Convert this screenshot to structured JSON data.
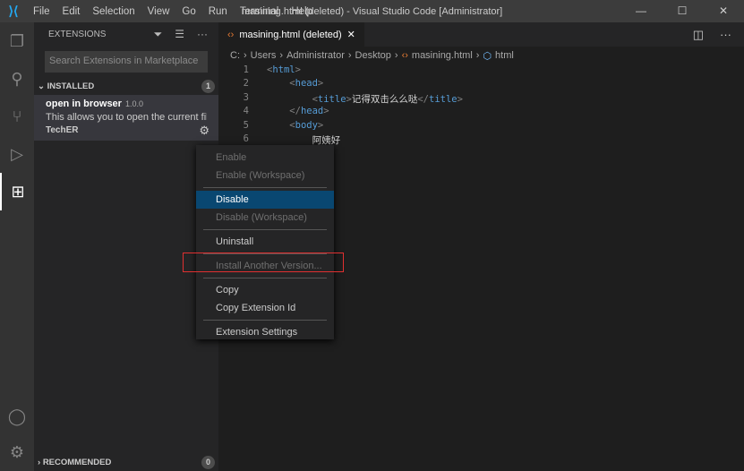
{
  "menu": [
    "File",
    "Edit",
    "Selection",
    "View",
    "Go",
    "Run",
    "Terminal",
    "Help"
  ],
  "window_title": "masining.html (deleted) - Visual Studio Code [Administrator]",
  "sidebar": {
    "title": "EXTENSIONS",
    "search_placeholder": "Search Extensions in Marketplace",
    "installed": {
      "label": "INSTALLED",
      "count": "1"
    },
    "extension": {
      "name": "open in browser",
      "version": "1.0.0",
      "description": "This allows you to open the current fil...",
      "author": "TechER"
    },
    "recommended": {
      "label": "RECOMMENDED",
      "count": "0"
    }
  },
  "editor": {
    "tab": "masining.html (deleted)",
    "breadcrumb": [
      "C:",
      "Users",
      "Administrator",
      "Desktop",
      "masining.html",
      "html"
    ],
    "lines": [
      {
        "n": "1",
        "indent": "",
        "open": "<",
        "tag": "html",
        "close": ">",
        "text": ""
      },
      {
        "n": "2",
        "indent": "    ",
        "open": "<",
        "tag": "head",
        "close": ">",
        "text": ""
      },
      {
        "n": "3",
        "indent": "        ",
        "open": "<",
        "tag": "title",
        "close": ">",
        "text": "记得双击么么哒",
        "end": "title"
      },
      {
        "n": "4",
        "indent": "    ",
        "open": "</",
        "tag": "head",
        "close": ">",
        "text": ""
      },
      {
        "n": "5",
        "indent": "    ",
        "open": "<",
        "tag": "body",
        "close": ">",
        "text": ""
      },
      {
        "n": "6",
        "indent": "        ",
        "open": "",
        "tag": "",
        "close": "",
        "text": "阿姨好"
      }
    ]
  },
  "context_menu": [
    {
      "label": "Enable",
      "disabled": true
    },
    {
      "label": "Enable (Workspace)",
      "disabled": true
    },
    {
      "sep": true
    },
    {
      "label": "Disable",
      "selected": true
    },
    {
      "label": "Disable (Workspace)",
      "disabled": true
    },
    {
      "sep": true
    },
    {
      "label": "Uninstall"
    },
    {
      "sep": true
    },
    {
      "label": "Install Another Version...",
      "disabled": true
    },
    {
      "sep": true
    },
    {
      "label": "Copy"
    },
    {
      "label": "Copy Extension Id"
    },
    {
      "sep": true
    },
    {
      "label": "Extension Settings"
    }
  ]
}
